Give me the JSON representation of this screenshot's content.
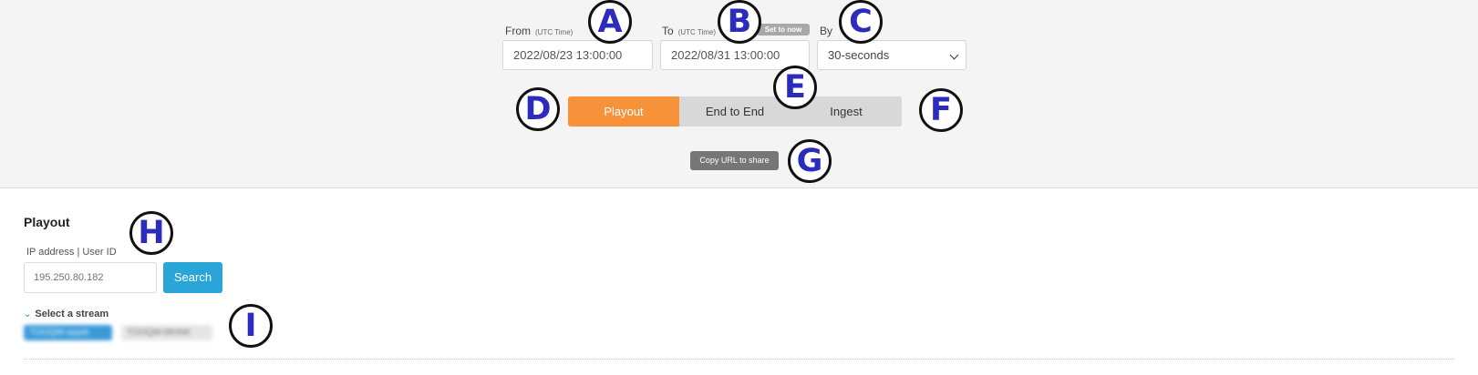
{
  "header": {
    "from": {
      "label": "From",
      "sub": "(UTC Time)",
      "value": "2022/08/23 13:00:00"
    },
    "to": {
      "label": "To",
      "sub": "(UTC Time)",
      "value": "2022/08/31 13:00:00",
      "set_now": "Set to now"
    },
    "by": {
      "label": "By",
      "selected": "30-seconds"
    },
    "tabs": [
      {
        "label": "Playout",
        "active": true
      },
      {
        "label": "End to End",
        "active": false
      },
      {
        "label": "Ingest",
        "active": false
      }
    ],
    "copy_url": "Copy URL to share"
  },
  "main": {
    "title": "Playout",
    "ip_label": "IP address | User ID",
    "ip_value": "195.250.80.182",
    "search": "Search",
    "stream_toggle": "Select a stream",
    "streams": [
      "TOOQM-sppdr",
      "TOOQM-MHNK"
    ]
  },
  "annotations": [
    "A",
    "B",
    "C",
    "D",
    "E",
    "F",
    "G",
    "H",
    "I"
  ],
  "colors": {
    "accent_orange": "#f7923a",
    "search_blue": "#2aa5d8",
    "badge_letter": "#2b2bbd"
  }
}
